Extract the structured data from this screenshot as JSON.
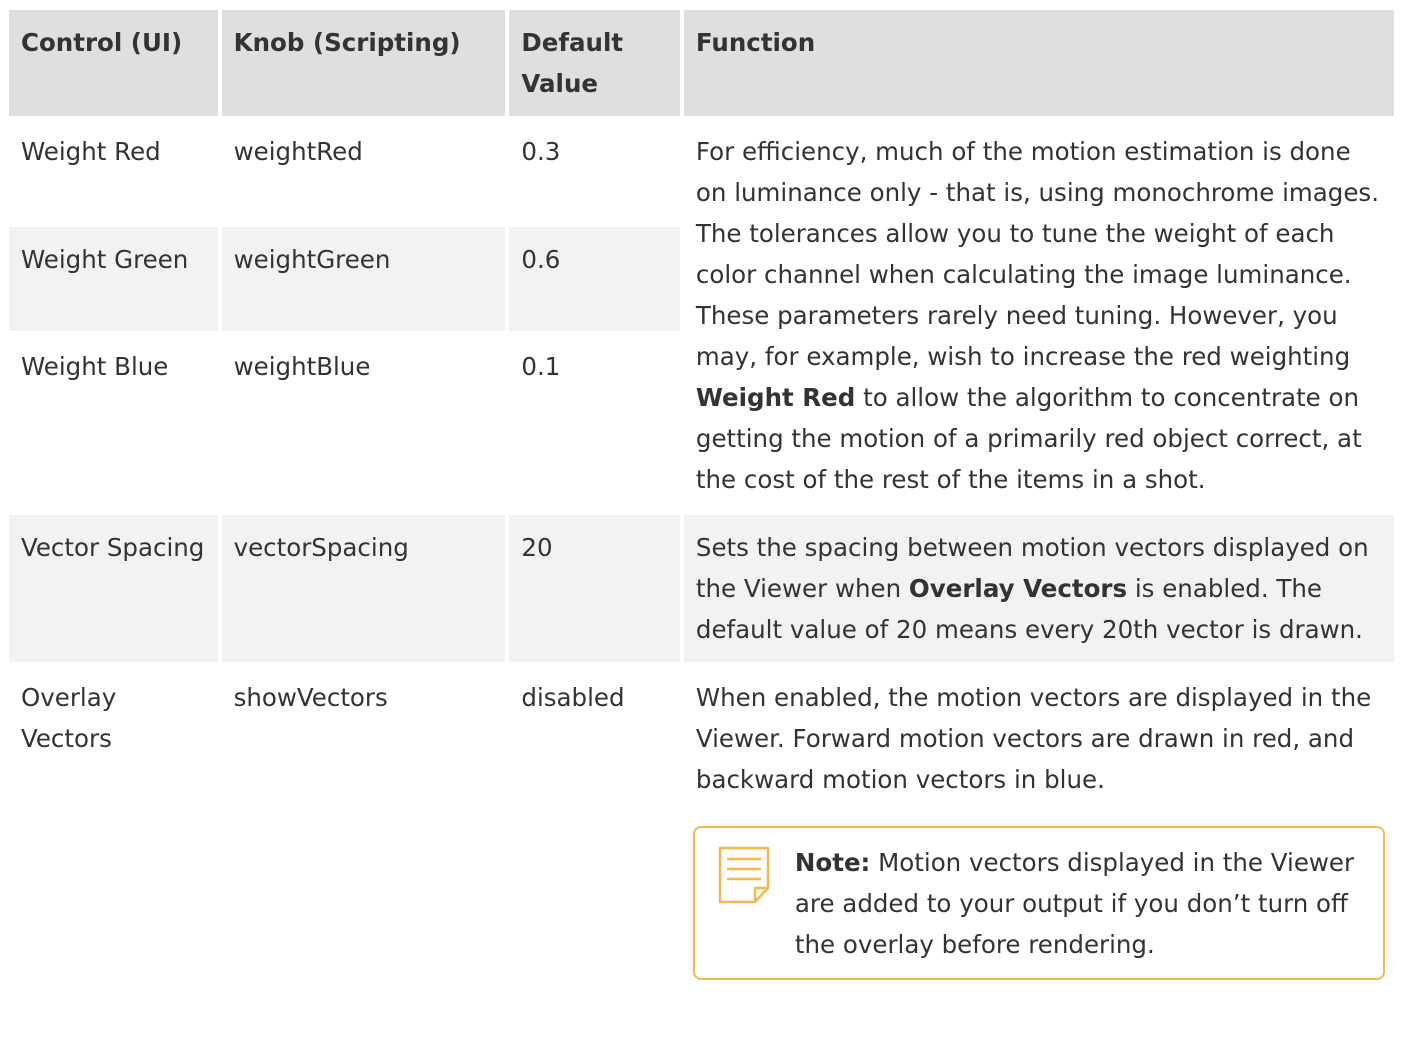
{
  "headers": {
    "control": "Control (UI)",
    "knob": "Knob (Scripting)",
    "default": "Default Value",
    "function": "Function"
  },
  "rows": [
    {
      "control": "Weight Red",
      "knob": "weightRed",
      "default": "0.3"
    },
    {
      "control": "Weight Green",
      "knob": "weightGreen",
      "default": "0.6"
    },
    {
      "control": "Weight Blue",
      "knob": "weightBlue",
      "default": "0.1"
    },
    {
      "control": "Vector Spacing",
      "knob": "vectorSpacing",
      "default": "20"
    },
    {
      "control": "Overlay Vectors",
      "knob": "showVectors",
      "default": "disabled"
    }
  ],
  "functions": {
    "weights": {
      "before": "For efficiency, much of the motion estimation is done on luminance only - that is, using monochrome images. The tolerances allow you to tune the weight of each color channel when calculating the image luminance. These parameters rarely need tuning. However, you may, for example, wish to increase the red weighting ",
      "bold": "Weight Red",
      "after": " to allow the algorithm to concentrate on getting the motion of a primarily red object correct, at the cost of the rest of the items in a shot."
    },
    "spacing": {
      "before": "Sets the spacing between motion vectors displayed on the Viewer when ",
      "bold": "Overlay Vectors",
      "after": " is enabled. The default value of 20 means every 20th vector is drawn."
    },
    "overlay": {
      "text": "When enabled, the motion vectors are displayed in the Viewer. Forward motion vectors are drawn in red, and backward motion vectors in blue.",
      "note_label": "Note:",
      "note_text": "Motion vectors displayed in the Viewer are added to your output if you don’t turn off the overlay before rendering."
    }
  },
  "colors": {
    "header_bg": "#dfdfdf",
    "row_alt_bg": "#f2f2f2",
    "note_border": "#f5b84b"
  },
  "icons": {
    "note": "note-icon"
  }
}
